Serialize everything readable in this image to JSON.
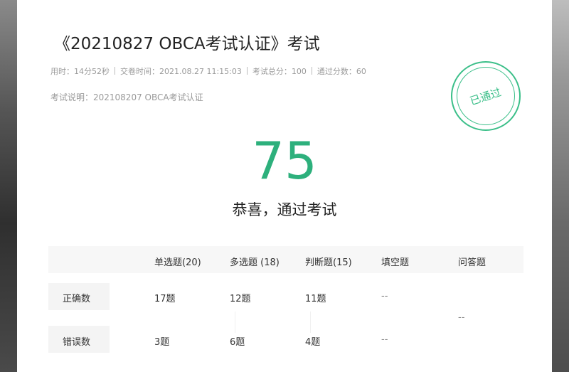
{
  "exam": {
    "title": "《20210827 OBCA考试认证》考试",
    "meta": {
      "time_used": "用时：14分52秒",
      "submit_time": "交卷时间：2021.08.27 11:15:03",
      "total_score": "考试总分：100",
      "pass_score": "通过分数：60"
    },
    "description": "考试说明：202108207 OBCA考试认证",
    "stamp": "已通过",
    "score": "75",
    "result_text": "恭喜，通过考试"
  },
  "table": {
    "headers": [
      "",
      "单选题(20)",
      "多选题 (18)",
      "判断题(15)",
      "填空题",
      "问答题"
    ],
    "rows": [
      {
        "label": "正确数",
        "cells": [
          "17题",
          "12题",
          "11题",
          "--"
        ]
      },
      {
        "label": "错误数",
        "cells": [
          "3题",
          "6题",
          "4题",
          "--"
        ]
      }
    ],
    "essay_value": "--"
  },
  "colors": {
    "accent": "#2db07c",
    "stamp": "#3bbf89"
  }
}
